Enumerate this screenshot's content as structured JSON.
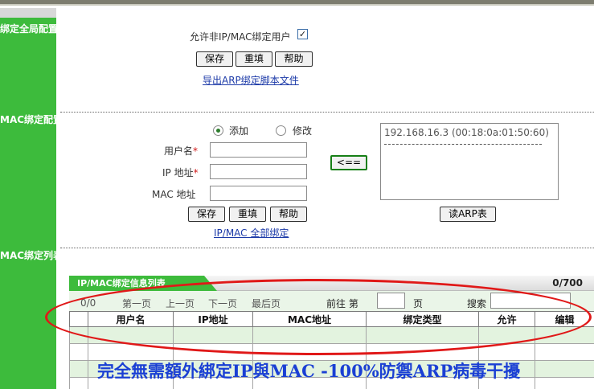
{
  "sidebar": {
    "section1_label": "绑定全局配置",
    "section2_label": "MAC绑定配置",
    "section3_label": "MAC绑定列表"
  },
  "global": {
    "allow_label": "允许非IP/MAC绑定用户",
    "allow_checked": true,
    "check_mark": "✓",
    "save_label": "保存",
    "reset_label": "重填",
    "help_label": "帮助",
    "export_link": "导出ARP绑定脚本文件"
  },
  "config": {
    "radio_add_label": "添加",
    "radio_modify_label": "修改",
    "selected_mode": "添加",
    "username_label": "用户名",
    "ip_label": "IP 地址",
    "mac_label": "MAC 地址",
    "required_mark": "*",
    "username_value": "",
    "ip_value": "",
    "mac_value": "",
    "transfer_label": "<==",
    "save_label": "保存",
    "reset_label": "重填",
    "help_label": "帮助",
    "bind_all_link": "IP/MAC 全部绑定",
    "arp_entries": [
      "192.168.16.3   (00:18:0a:01:50:60)"
    ],
    "read_arp_label": "读ARP表"
  },
  "list": {
    "tab_title": "IP/MAC绑定信息列表",
    "count": "0/700",
    "page_indicator": "0/0",
    "first_page": "第一页",
    "prev_page": "上一页",
    "next_page": "下一页",
    "last_page": "最后页",
    "goto_label": "前往  第",
    "page_unit": "页",
    "search_label": "搜索",
    "goto_value": "",
    "search_value": "",
    "columns": [
      "用户名",
      "IP地址",
      "MAC地址",
      "绑定类型",
      "允许",
      "编辑"
    ]
  },
  "overlay_text": "完全無需額外綁定IP與MAC  -100%防禦ARP病毒干擾",
  "colors": {
    "sidebar_green": "#3dbb3c",
    "link_blue": "#1c3aa8",
    "highlight_red": "#e01818",
    "overlay_blue": "#1a3fd4"
  }
}
